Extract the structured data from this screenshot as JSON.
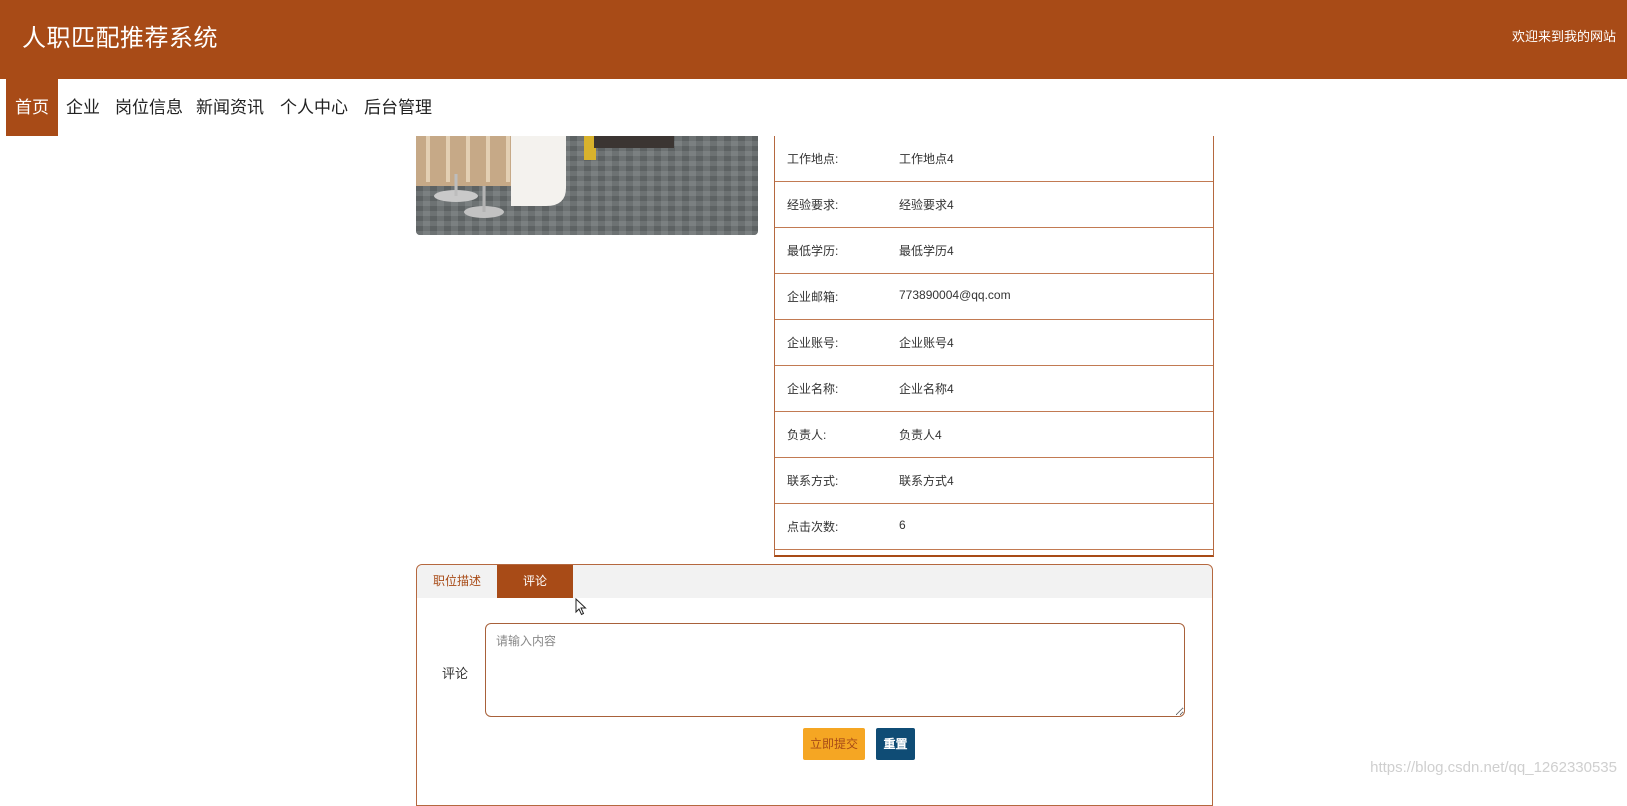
{
  "header": {
    "site_title": "人职匹配推荐系统",
    "welcome": "欢迎来到我的网站"
  },
  "nav": {
    "items": [
      "首页",
      "企业",
      "岗位信息",
      "新闻资讯",
      "个人中心",
      "后台管理"
    ],
    "active": "首页"
  },
  "details": [
    {
      "label": "工作地点:",
      "value": "工作地点4"
    },
    {
      "label": "经验要求:",
      "value": "经验要求4"
    },
    {
      "label": "最低学历:",
      "value": "最低学历4"
    },
    {
      "label": "企业邮箱:",
      "value": "773890004@qq.com"
    },
    {
      "label": "企业账号:",
      "value": "企业账号4"
    },
    {
      "label": "企业名称:",
      "value": "企业名称4"
    },
    {
      "label": "负责人:",
      "value": "负责人4"
    },
    {
      "label": "联系方式:",
      "value": "联系方式4"
    },
    {
      "label": "点击次数:",
      "value": "6"
    }
  ],
  "tabs": {
    "items": [
      "职位描述",
      "评论"
    ],
    "active": "评论"
  },
  "comment_form": {
    "label": "评论",
    "placeholder": "请输入内容",
    "value": "",
    "submit_label": "立即提交",
    "reset_label": "重置"
  },
  "watermark": "https://blog.csdn.net/qq_1262330535",
  "colors": {
    "brand": "#a84b17",
    "submit": "#f5a623",
    "reset": "#0f4c75"
  }
}
